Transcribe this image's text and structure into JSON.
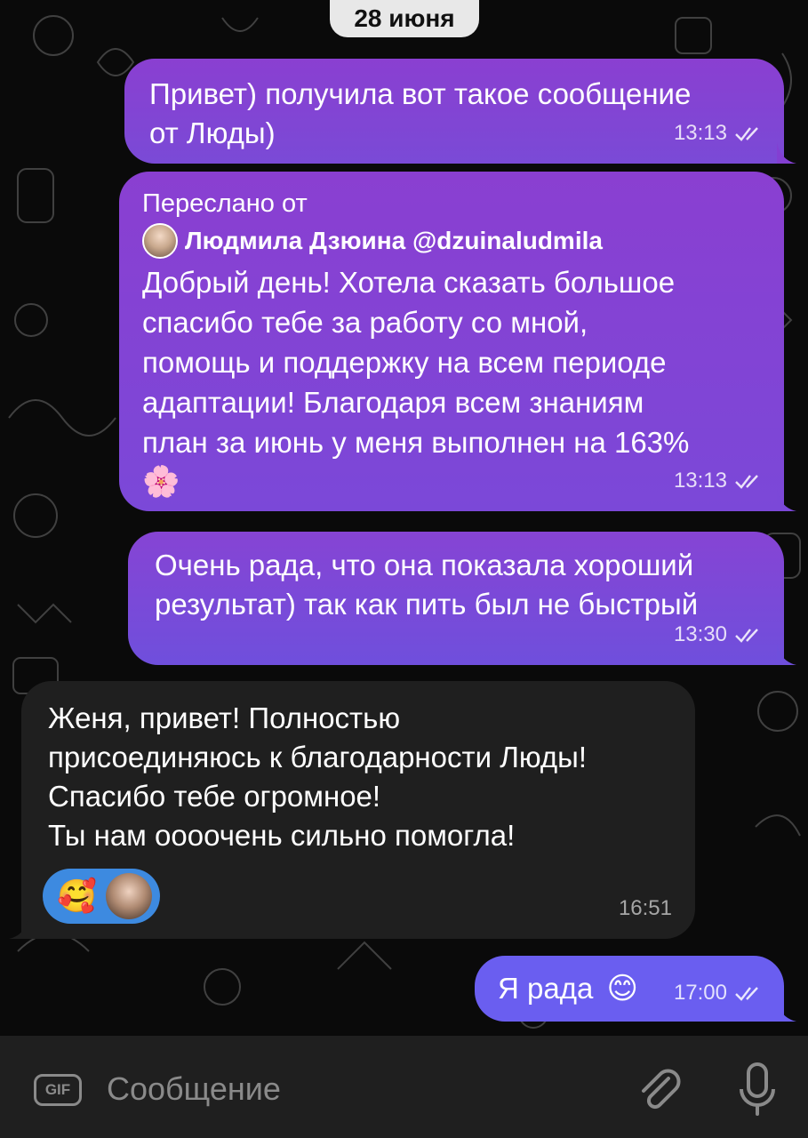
{
  "chat": {
    "date": "28 июня",
    "messages": [
      {
        "direction": "out",
        "text": "Привет) получила вот такое сообщение\nот Люды)",
        "time": "13:13",
        "status": "read"
      },
      {
        "direction": "out",
        "forwarded_label": "Переслано от",
        "forwarded_from": "Людмила Дзюина @dzuinaludmila",
        "text": "Добрый день! Хотела сказать большое\nспасибо тебе за работу со мной,\nпомощь и поддержку на всем периоде\nадаптации! Благодаря всем знаниям\nплан за июнь у меня выполнен на 163%",
        "emoji": "🌸",
        "time": "13:13",
        "status": "read"
      },
      {
        "direction": "out",
        "text": "Очень рада, что она показала хороший\nрезультат) так как пить был не быстрый",
        "time": "13:30",
        "status": "read"
      },
      {
        "direction": "in",
        "text": "Женя, привет! Полностью\nприсоединяюсь к благодарности Люды!\nСпасибо тебе огромное!\nТы нам оооочень сильно помогла!",
        "reaction_emoji": "🥰",
        "time": "16:51"
      },
      {
        "direction": "out",
        "text": "Я рада",
        "emoji": "😊",
        "time": "17:00",
        "status": "read"
      }
    ]
  },
  "input": {
    "gif_label": "GIF",
    "placeholder": "Сообщение",
    "attach_icon": "paperclip-icon",
    "mic_icon": "microphone-icon"
  },
  "colors": {
    "outgoing_bubble_top": "#8a3fd1",
    "outgoing_bubble_bottom": "#7a4ad6",
    "last_outgoing_bubble": "#6a5ef0",
    "incoming_bubble": "#1f1f1f",
    "reaction_bg": "#3d8ae0",
    "date_pill": "#e8e8e8"
  }
}
